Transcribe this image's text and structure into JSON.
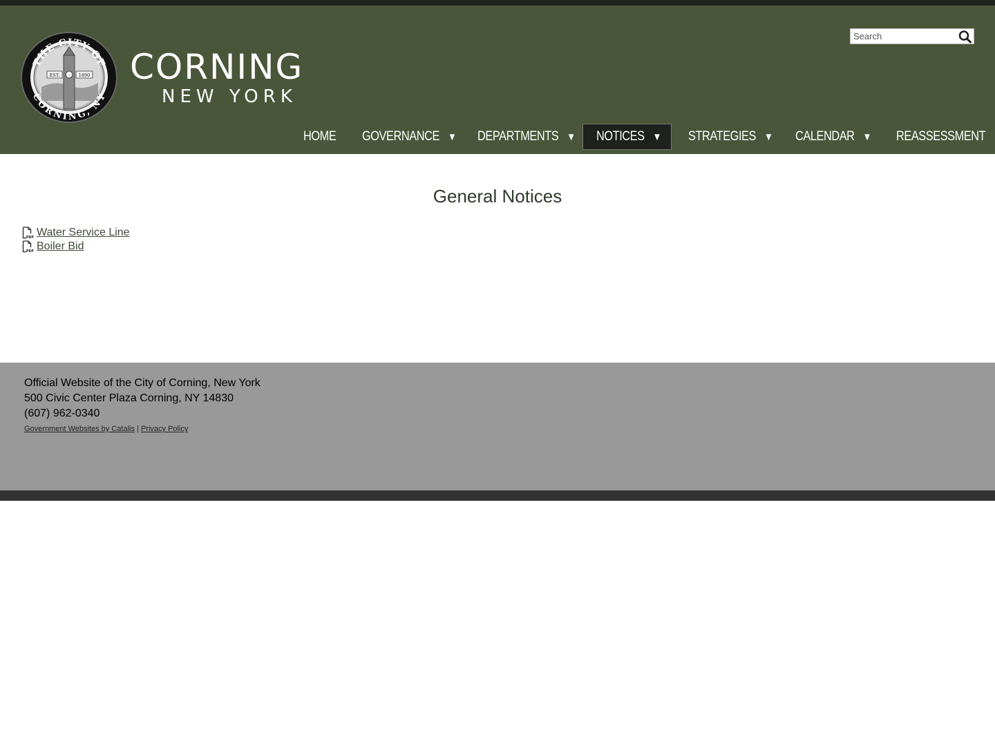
{
  "header": {
    "seal_text_top": "THE CITY OF",
    "seal_text_bottom": "CORNING, NY",
    "seal_est": "EST.",
    "seal_year": "1890",
    "wordmark_line1": "CORNING",
    "wordmark_line2": "NEW YORK",
    "search": {
      "placeholder": "Search"
    }
  },
  "nav": {
    "items": [
      {
        "label": "HOME",
        "has_dropdown": false,
        "active": false
      },
      {
        "label": "GOVERNANCE",
        "has_dropdown": true,
        "active": false
      },
      {
        "label": "DEPARTMENTS",
        "has_dropdown": true,
        "active": false
      },
      {
        "label": "NOTICES",
        "has_dropdown": true,
        "active": true
      },
      {
        "label": "STRATEGIES",
        "has_dropdown": true,
        "active": false
      },
      {
        "label": "CALENDAR",
        "has_dropdown": true,
        "active": false
      },
      {
        "label": "REASSESSMENT",
        "has_dropdown": false,
        "active": false
      }
    ],
    "dropdown_glyph": "▼"
  },
  "main": {
    "title": "General Notices",
    "documents": [
      {
        "label": "Water Service Line",
        "icon": "pdf-file-icon"
      },
      {
        "label": "Boiler Bid",
        "icon": "pdf-file-icon"
      }
    ]
  },
  "footer": {
    "line1": "Official Website of the City of Corning, New York",
    "line2": "500 Civic Center Plaza Corning, NY 14830",
    "line3": "(607) 962-0340",
    "link_catalis": "Government Websites by Catalis",
    "separator": "|",
    "link_privacy": "Privacy Policy"
  },
  "colors": {
    "header_bg": "#4a5639",
    "top_bar": "#1e211c",
    "active_nav_bg": "#1e211c",
    "footer_bg": "#999999",
    "bottom_bar": "#333333",
    "title_text": "#2e3a2a"
  }
}
